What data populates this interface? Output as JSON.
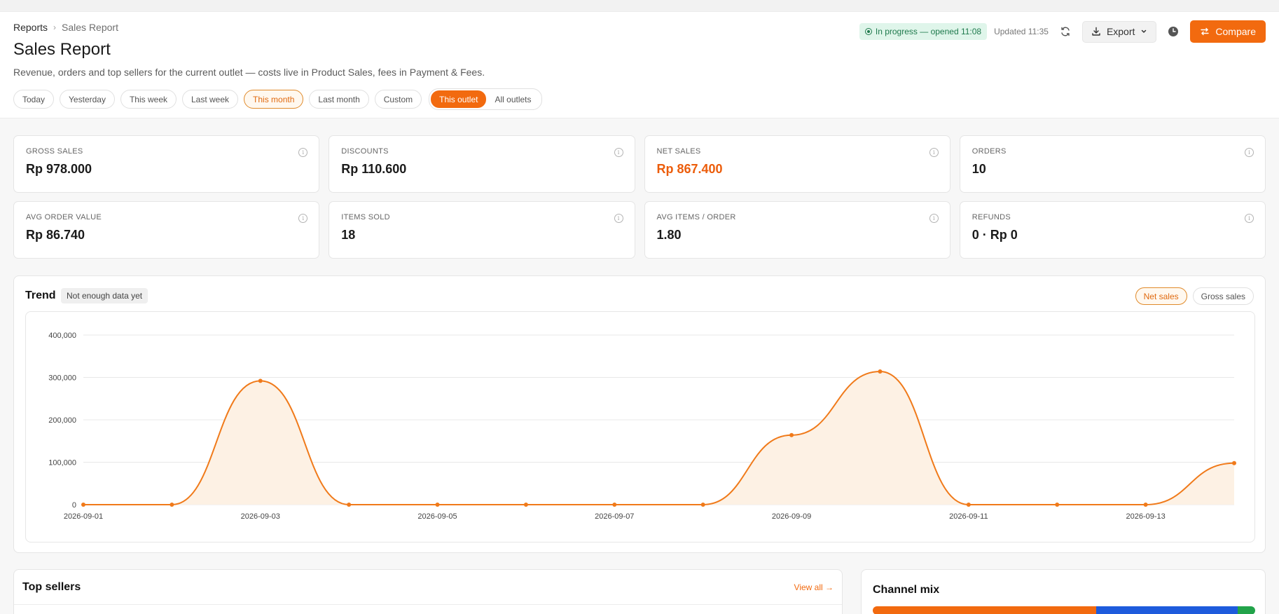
{
  "breadcrumb": {
    "root": "Reports",
    "current": "Sales Report"
  },
  "page": {
    "title": "Sales Report",
    "subtitle": "Revenue, orders and top sellers for the current outlet — costs live in Product Sales, fees in Payment & Fees."
  },
  "status": {
    "badge": "In progress — opened 11:08",
    "updated": "Updated 11:35"
  },
  "actions": {
    "export_label": "Export",
    "compare_label": "Compare"
  },
  "filters": {
    "ranges": [
      "Today",
      "Yesterday",
      "This week",
      "Last week",
      "This month",
      "Last month",
      "Custom"
    ],
    "active_range": "This month",
    "scope": [
      "This outlet",
      "All outlets"
    ],
    "active_scope": "This outlet"
  },
  "kpis": [
    {
      "label": "GROSS SALES",
      "value": "Rp 978.000"
    },
    {
      "label": "DISCOUNTS",
      "value": "Rp 110.600"
    },
    {
      "label": "NET SALES",
      "value": "Rp 867.400",
      "accent": true
    },
    {
      "label": "ORDERS",
      "value": "10"
    },
    {
      "label": "AVG ORDER VALUE",
      "value": "Rp 86.740"
    },
    {
      "label": "ITEMS SOLD",
      "value": "18"
    },
    {
      "label": "AVG ITEMS / ORDER",
      "value": "1.80"
    },
    {
      "label": "REFUNDS",
      "value": "0 · Rp 0"
    }
  ],
  "trend": {
    "title": "Trend",
    "badge": "Not enough data yet",
    "metrics": [
      "Net sales",
      "Gross sales"
    ],
    "active_metric": "Net sales"
  },
  "chart_data": {
    "type": "area",
    "x": [
      "2026-09-01",
      "2026-09-02",
      "2026-09-03",
      "2026-09-04",
      "2026-09-05",
      "2026-09-06",
      "2026-09-07",
      "2026-09-08",
      "2026-09-09",
      "2026-09-10",
      "2026-09-11",
      "2026-09-12",
      "2026-09-13",
      "2026-09-14"
    ],
    "tick_labels": [
      "2026-09-01",
      "2026-09-03",
      "2026-09-05",
      "2026-09-07",
      "2026-09-09",
      "2026-09-11",
      "2026-09-13"
    ],
    "series": [
      {
        "values": [
          0,
          0,
          292000,
          0,
          0,
          0,
          0,
          0,
          164000,
          314000,
          0,
          0,
          0,
          98000
        ]
      }
    ],
    "ylim": [
      0,
      400000
    ],
    "yticks": [
      "0",
      "100,000",
      "200,000",
      "300,000",
      "400,000"
    ],
    "y_tick_values": [
      0,
      100000,
      200000,
      300000,
      400000
    ],
    "grid": true,
    "colors": {
      "line": "#f07a1a",
      "fill": "#fdf1e4",
      "grid": "#e8e8e8"
    }
  },
  "top_sellers": {
    "title": "Top sellers",
    "view_all": "View all →"
  },
  "channel_mix": {
    "title": "Channel mix",
    "segments": [
      {
        "share": 0.585,
        "color": "#f26a0f"
      },
      {
        "share": 0.37,
        "color": "#1e5bdc"
      },
      {
        "share": 0.045,
        "color": "#22a34a"
      }
    ]
  }
}
